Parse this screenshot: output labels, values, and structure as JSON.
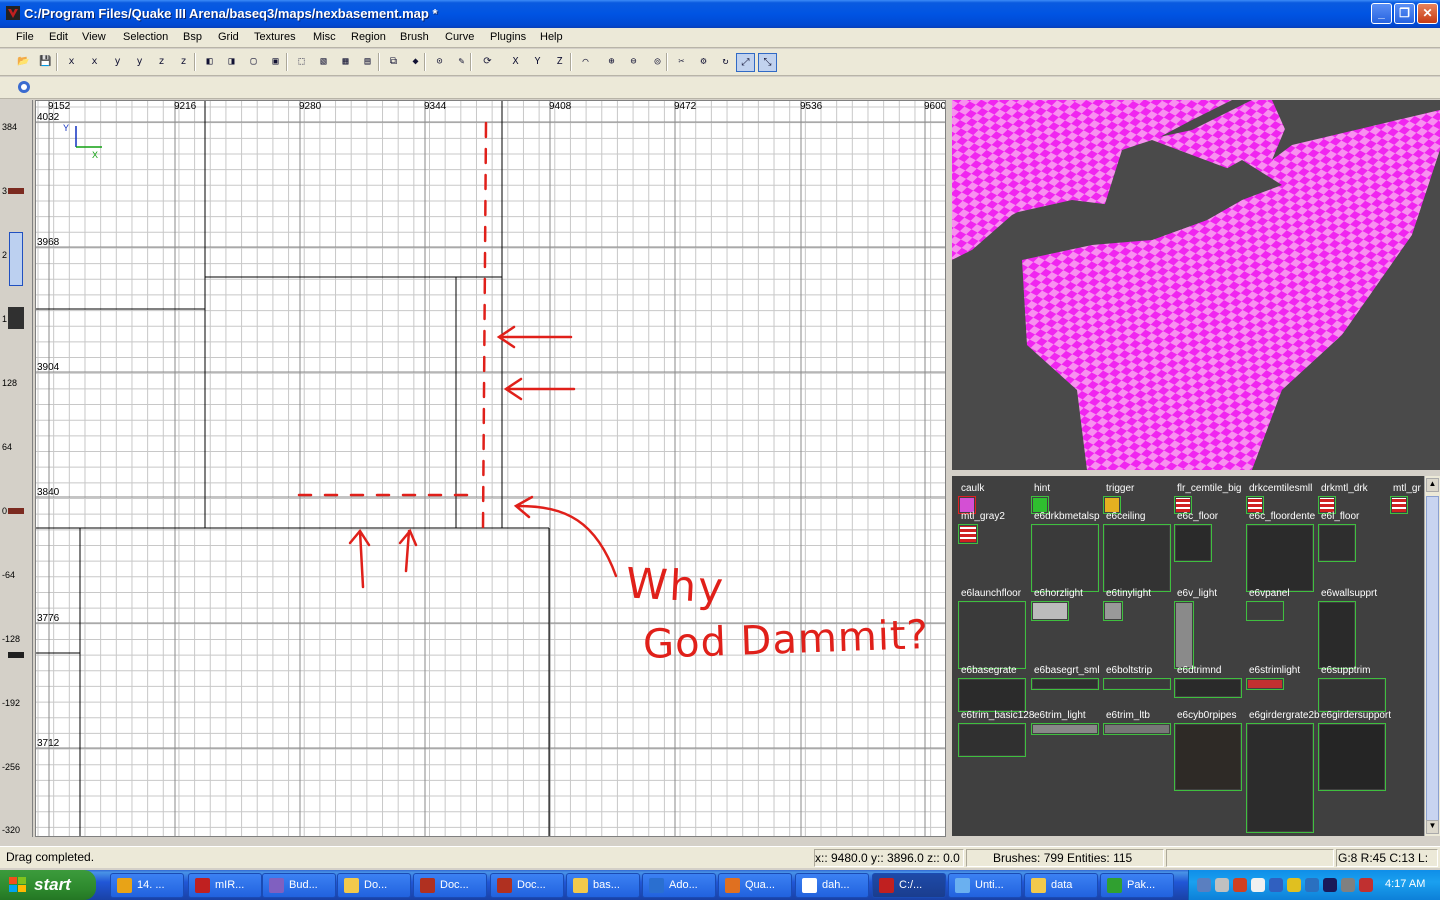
{
  "window": {
    "title": "C:/Program Files/Quake III Arena/baseq3/maps/nexbasement.map *",
    "buttons": [
      "_",
      "❐",
      "✕"
    ]
  },
  "menu": [
    "File",
    "Edit",
    "View",
    "Selection",
    "Bsp",
    "Grid",
    "Textures",
    "Misc",
    "Region",
    "Brush",
    "Curve",
    "Plugins",
    "Help"
  ],
  "toolbar": {
    "buttons": [
      "open",
      "save",
      "x-flip",
      "x-rotate",
      "y-flip",
      "y-rotate",
      "z-flip",
      "z-rotate",
      "csg-subtract",
      "csg-merge",
      "hollow",
      "clone",
      "select-complete",
      "select-touching",
      "select-partial",
      "select-inside",
      "cube-clip",
      "cubic",
      "camera-lock",
      "texture-lock",
      "view-change",
      "view-x",
      "view-y",
      "view-z",
      "patch-bend",
      "patch-insert",
      "patch-delete",
      "show-patch",
      "clip",
      "entity",
      "rotate",
      "scale",
      "select-drag",
      "stop"
    ],
    "labels": [
      "X",
      "Y",
      "Z"
    ],
    "row2_icon": "q3-plugin-icon"
  },
  "grid_view": {
    "x_ticks": [
      "9152",
      "9216",
      "9280",
      "9344",
      "9408",
      "9472",
      "9536",
      "9600"
    ],
    "y_ticks": [
      "4032",
      "3968",
      "3904",
      "3840",
      "3776",
      "3712"
    ],
    "axis_x": "X",
    "axis_y": "Y",
    "annotation_line1": "Why",
    "annotation_line2": "God Dammit?",
    "annotation_color": "#e0201a"
  },
  "z_ruler": {
    "ticks": [
      "384",
      "3",
      "2",
      "1",
      "128",
      "64",
      "0",
      "-64",
      "-128",
      "-192",
      "-256",
      "-320"
    ]
  },
  "textures": [
    {
      "name": "caulk",
      "color": "#d44fd4"
    },
    {
      "name": "hint",
      "color": "#2fbf2f"
    },
    {
      "name": "trigger",
      "color": "#e5b020"
    },
    {
      "name": "flr_cemtile_big",
      "color": "#4a4a4a"
    },
    {
      "name": "drkcemtilesmll",
      "color": "#4a4a4a"
    },
    {
      "name": "drkmtl_drk",
      "color": "#4a4a4a"
    },
    {
      "name": "mtl_gr",
      "color": "#4a4a4a"
    },
    {
      "name": "mtl_gray2",
      "color": "#4a4a4a"
    },
    {
      "name": "e6drkbmetalsp",
      "color": "#3a3a3a"
    },
    {
      "name": "e6ceiling",
      "color": "#333333"
    },
    {
      "name": "e6c_floor",
      "color": "#2a2a2a"
    },
    {
      "name": "e6c_floordente",
      "color": "#2b2b2b"
    },
    {
      "name": "e6l_floor",
      "color": "#2e2e2e"
    },
    {
      "name": "e6launchfloor",
      "color": "#3a3a3a"
    },
    {
      "name": "e6horzlight",
      "color": "#bbbbbb"
    },
    {
      "name": "e6tinylight",
      "color": "#999999"
    },
    {
      "name": "e6v_light",
      "color": "#8a8a8a"
    },
    {
      "name": "e6vpanel",
      "color": "#3d3d3d"
    },
    {
      "name": "e6wallsupprt",
      "color": "#2a2a2a"
    },
    {
      "name": "e6basegrate",
      "color": "#2b2b2b"
    },
    {
      "name": "e6basegrt_sml",
      "color": "#2f2f2f"
    },
    {
      "name": "e6boltstrip",
      "color": "#3a3a3a"
    },
    {
      "name": "e6dtrimnd",
      "color": "#2a2a2a"
    },
    {
      "name": "e6strimlight",
      "color": "#c23030"
    },
    {
      "name": "e6supptrim",
      "color": "#333333"
    },
    {
      "name": "e6trim_basic128",
      "color": "#303030"
    },
    {
      "name": "e6trim_light",
      "color": "#888888"
    },
    {
      "name": "e6trim_ltb",
      "color": "#777777"
    },
    {
      "name": "e6cyb0rpipes",
      "color": "#2e2a26"
    },
    {
      "name": "e6girdergrate2b",
      "color": "#2c2c2c"
    },
    {
      "name": "e6girdersupport",
      "color": "#252525"
    }
  ],
  "status": {
    "message": "Drag completed.",
    "coords": "x:: 9480.0  y:: 3896.0  z:: 0.0",
    "counts": "Brushes: 799 Entities: 115",
    "grid": "G:8 R:45 C:13 L:"
  },
  "taskbar": {
    "start_label": "start",
    "tasks": [
      {
        "label": "14. ...",
        "icon": "winamp-icon",
        "color": "#e8a317"
      },
      {
        "label": "mIR...",
        "icon": "mirc-icon",
        "color": "#c02020"
      },
      {
        "label": "Bud...",
        "icon": "buddy-icon",
        "color": "#8060c0"
      },
      {
        "label": "Do...",
        "icon": "folder-icon",
        "color": "#f2c94c"
      },
      {
        "label": "Doc...",
        "icon": "quake-icon",
        "color": "#b03020"
      },
      {
        "label": "Doc...",
        "icon": "quake-icon",
        "color": "#b03020"
      },
      {
        "label": "bas...",
        "icon": "folder-icon",
        "color": "#f2c94c"
      },
      {
        "label": "Ado...",
        "icon": "adobe-icon",
        "color": "#2a6fd0"
      },
      {
        "label": "Qua...",
        "icon": "firefox-icon",
        "color": "#e07020"
      },
      {
        "label": "dah...",
        "icon": "image-icon",
        "color": "#ffffff"
      },
      {
        "label": "C:/...",
        "icon": "radiant-icon",
        "color": "#c02020"
      },
      {
        "label": "Unti...",
        "icon": "notepad-icon",
        "color": "#6ab0f0"
      },
      {
        "label": "data",
        "icon": "folder-icon",
        "color": "#f2c94c"
      },
      {
        "label": "Pak...",
        "icon": "pakscape-icon",
        "color": "#30a030"
      }
    ],
    "clock": "4:17 AM"
  }
}
